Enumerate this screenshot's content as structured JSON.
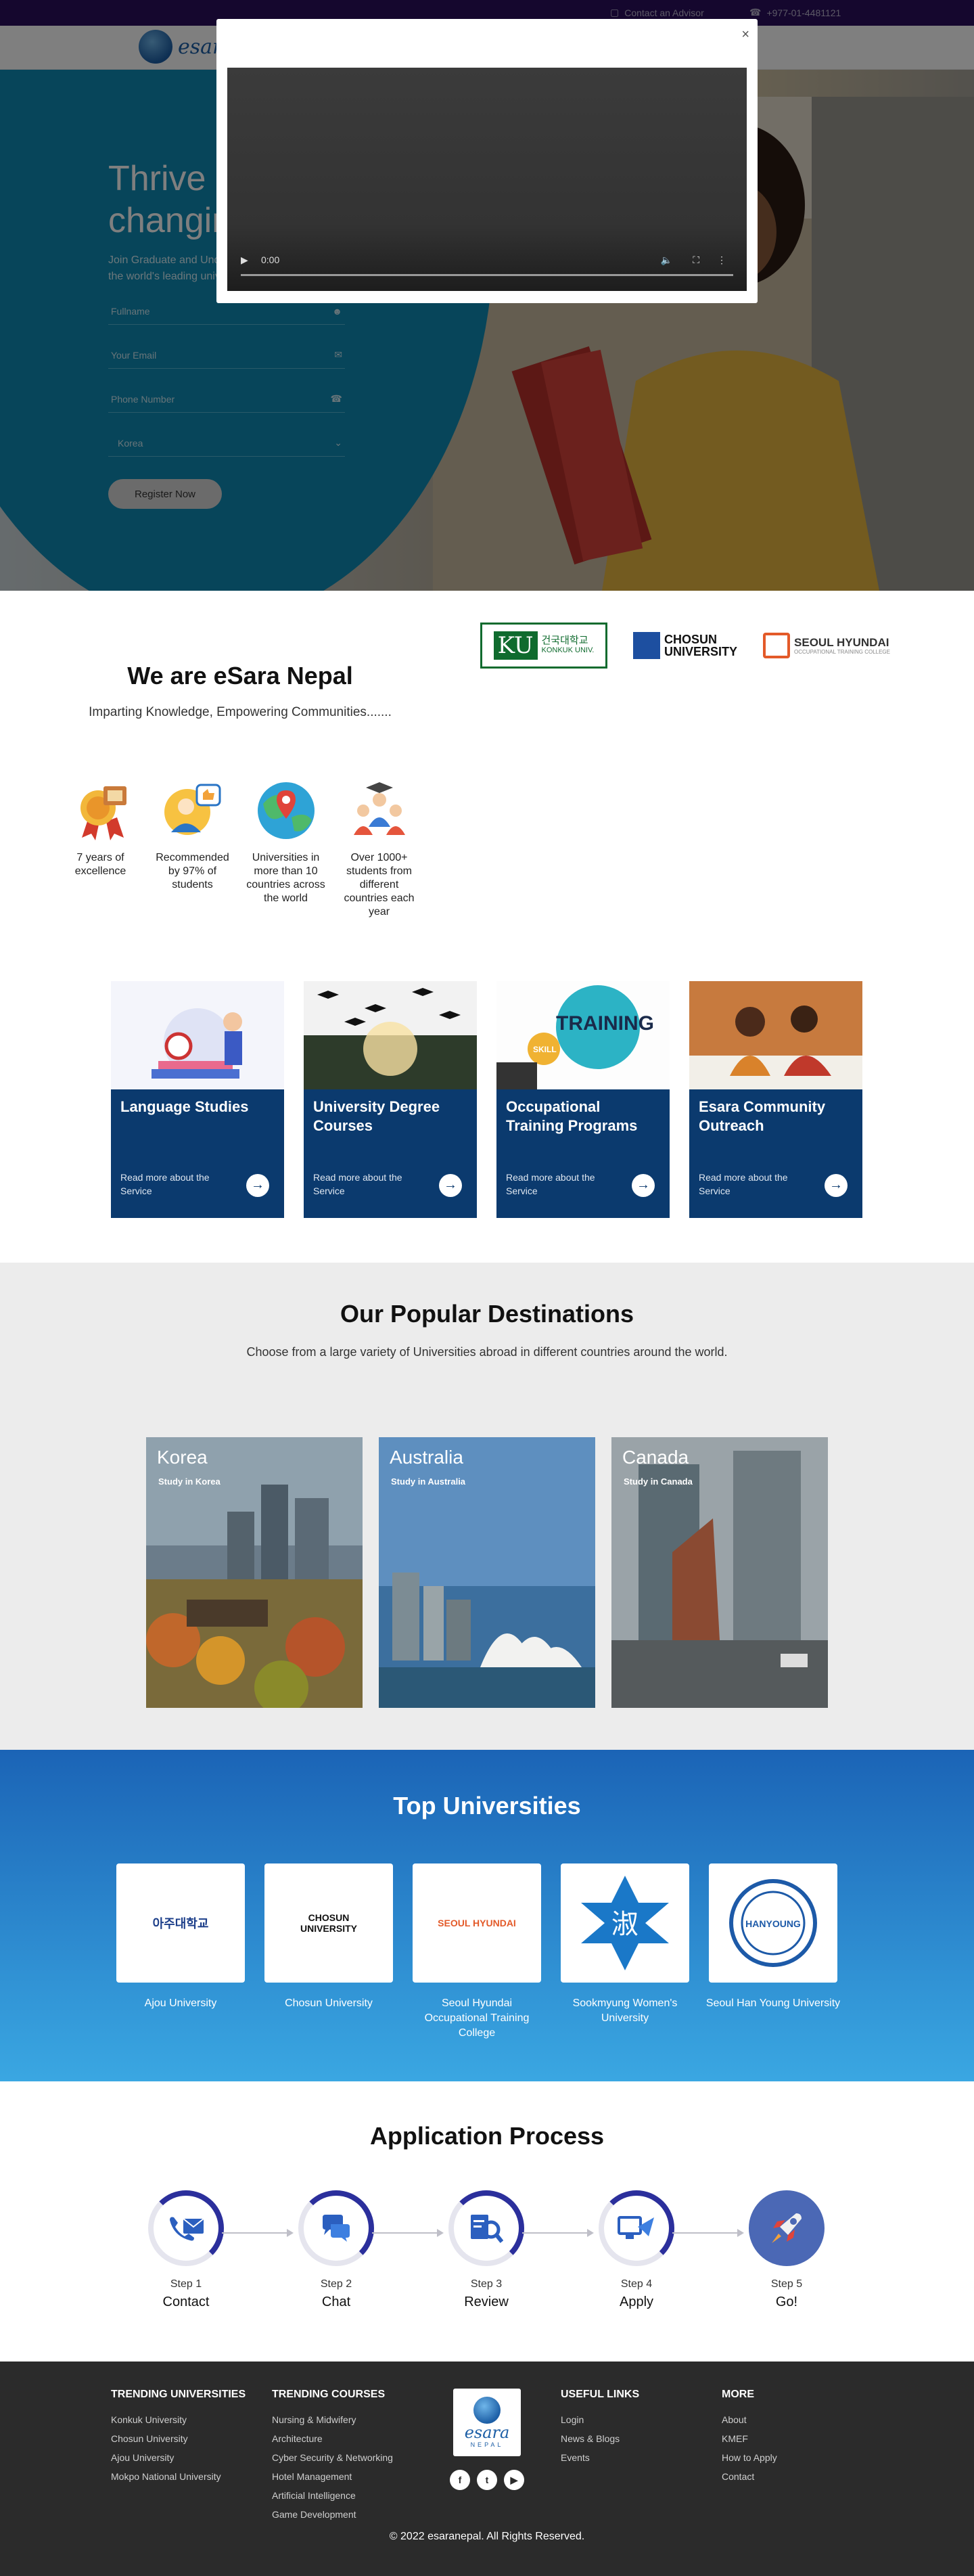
{
  "topbar": {
    "advisor": "Contact an Advisor",
    "phone": "+977-01-4481121"
  },
  "brand": {
    "name": "esara",
    "sub": "NEPAL"
  },
  "hero": {
    "title": "Thrive in a changing world",
    "subtitle": "Join Graduate and Undergraduate programs at the world's leading universities",
    "form": {
      "fullname": "Fullname",
      "email": "Your Email",
      "phone": "Phone Number",
      "country": "Korea",
      "submit": "Register Now"
    }
  },
  "modal": {
    "close": "×",
    "time": "0:00"
  },
  "partners": {
    "konkuk": {
      "mark": "KU",
      "text1": "건국대학교",
      "text2": "KONKUK UNIV."
    },
    "chosun": {
      "line1": "CHOSUN",
      "line2": "UNIVERSITY"
    },
    "hyundai": {
      "line1": "SEOUL HYUNDAI",
      "line2": "OCCUPATIONAL TRAINING COLLEGE"
    }
  },
  "about": {
    "title": "We are eSara Nepal",
    "tagline": "Imparting Knowledge, Empowering Communities.......",
    "stats": [
      {
        "icon": "award-medal-icon",
        "label": "7 years of excellence"
      },
      {
        "icon": "recommend-thumbs-up-icon",
        "label": "Recommended by 97% of students"
      },
      {
        "icon": "globe-location-icon",
        "label": "Universities in more than 10 countries across the world"
      },
      {
        "icon": "students-group-icon",
        "label": "Over 1000+ students from different countries each year"
      }
    ]
  },
  "services": [
    {
      "title": "Language Studies",
      "link": "Read more about the Service"
    },
    {
      "title": "University Degree Courses",
      "link": "Read more about the Service"
    },
    {
      "title": "Occupational Training Programs",
      "link": "Read more about the Service"
    },
    {
      "title": "Esara Community Outreach",
      "link": "Read more about the Service"
    }
  ],
  "service_images": {
    "training_text": "TRAINING",
    "skill": "SKILL"
  },
  "destinations": {
    "title": "Our Popular Destinations",
    "subtitle": "Choose from a large variety of Universities abroad in different countries around the world.",
    "items": [
      {
        "name": "Korea",
        "sub": "Study in Korea"
      },
      {
        "name": "Australia",
        "sub": "Study in Australia"
      },
      {
        "name": "Canada",
        "sub": "Study in Canada"
      }
    ]
  },
  "universities": {
    "title": "Top Universities",
    "items": [
      {
        "name": "Ajou University",
        "logo": "아주대학교"
      },
      {
        "name": "Chosun University",
        "logo": "CHOSUN UNIVERSITY"
      },
      {
        "name": "Seoul Hyundai Occupational Training College",
        "logo": "SEOUL HYUNDAI"
      },
      {
        "name": "Sookmyung Women's University",
        "logo": "淑"
      },
      {
        "name": "Seoul Han Young University",
        "logo": "HANYOUNG"
      }
    ]
  },
  "process": {
    "title": "Application Process",
    "steps": [
      {
        "num": "Step 1",
        "label": "Contact",
        "icon": "phone-mail-icon"
      },
      {
        "num": "Step 2",
        "label": "Chat",
        "icon": "chat-bubbles-icon"
      },
      {
        "num": "Step 3",
        "label": "Review",
        "icon": "document-search-icon"
      },
      {
        "num": "Step 4",
        "label": "Apply",
        "icon": "monitor-send-icon"
      },
      {
        "num": "Step 5",
        "label": "Go!",
        "icon": "rocket-icon"
      }
    ]
  },
  "footer": {
    "trending_universities": {
      "title": "TRENDING UNIVERSITIES",
      "items": [
        "Konkuk University",
        "Chosun University",
        "Ajou University",
        "Mokpo National University"
      ]
    },
    "trending_courses": {
      "title": "TRENDING COURSES",
      "items": [
        "Nursing & Midwifery",
        "Architecture",
        "Cyber Security & Networking",
        "Hotel Management",
        "Artificial Intelligence",
        "Game Development"
      ]
    },
    "useful_links": {
      "title": "USEFUL LINKS",
      "items": [
        "Login",
        "News & Blogs",
        "Events"
      ]
    },
    "more": {
      "title": "MORE",
      "items": [
        "About",
        "KMEF",
        "How to Apply",
        "Contact"
      ]
    },
    "copyright": "© 2022 esaranepal. All Rights Reserved."
  },
  "colors": {
    "topbar": "#2a0f5c",
    "hero_circle": "#0e8bb4",
    "service_card": "#0b3a6e",
    "footer": "#2b2b2b",
    "uni_gradient_top": "#1b64b6"
  }
}
